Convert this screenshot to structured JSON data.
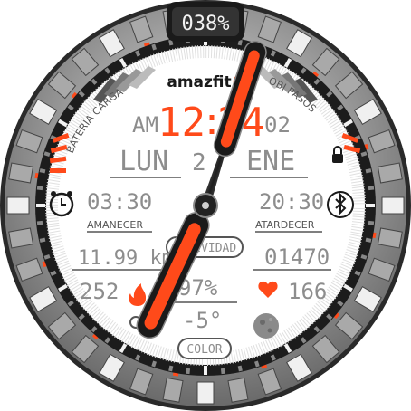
{
  "battery": {
    "text": "038%",
    "level_percent": 38
  },
  "brand": "amazfit",
  "time": {
    "ampm": "AM",
    "hour": "12",
    "minute": "24",
    "seconds": "02"
  },
  "date": {
    "weekday": "LUN",
    "day": "2",
    "month": "ENE"
  },
  "arc_labels": {
    "left": "BATERIA CARGA",
    "right": "OBJ PASOS"
  },
  "sunrise": {
    "time": "03:30",
    "label": "AMANECER"
  },
  "sunset": {
    "time": "20:30",
    "label": "ATARDECER"
  },
  "activity_button": "ACTIVIDAD",
  "distance": "11.99 km",
  "steps": "01470",
  "calories": "252",
  "humidity": "97%",
  "heart_rate": "166",
  "temperature": "-5°",
  "color_button": "COLOR",
  "hands": {
    "hour_deg": 205,
    "minute_deg": 18
  },
  "colors": {
    "accent": "#ff4a1a",
    "lcd": "#8d8d8d",
    "dark": "#1a1a1a",
    "bezel": "#bdbdbd"
  },
  "icons": [
    "alarm-icon",
    "bluetooth-icon",
    "flame-icon",
    "heart-icon",
    "moon-phase-icon",
    "weather-icon",
    "lock-icon"
  ]
}
